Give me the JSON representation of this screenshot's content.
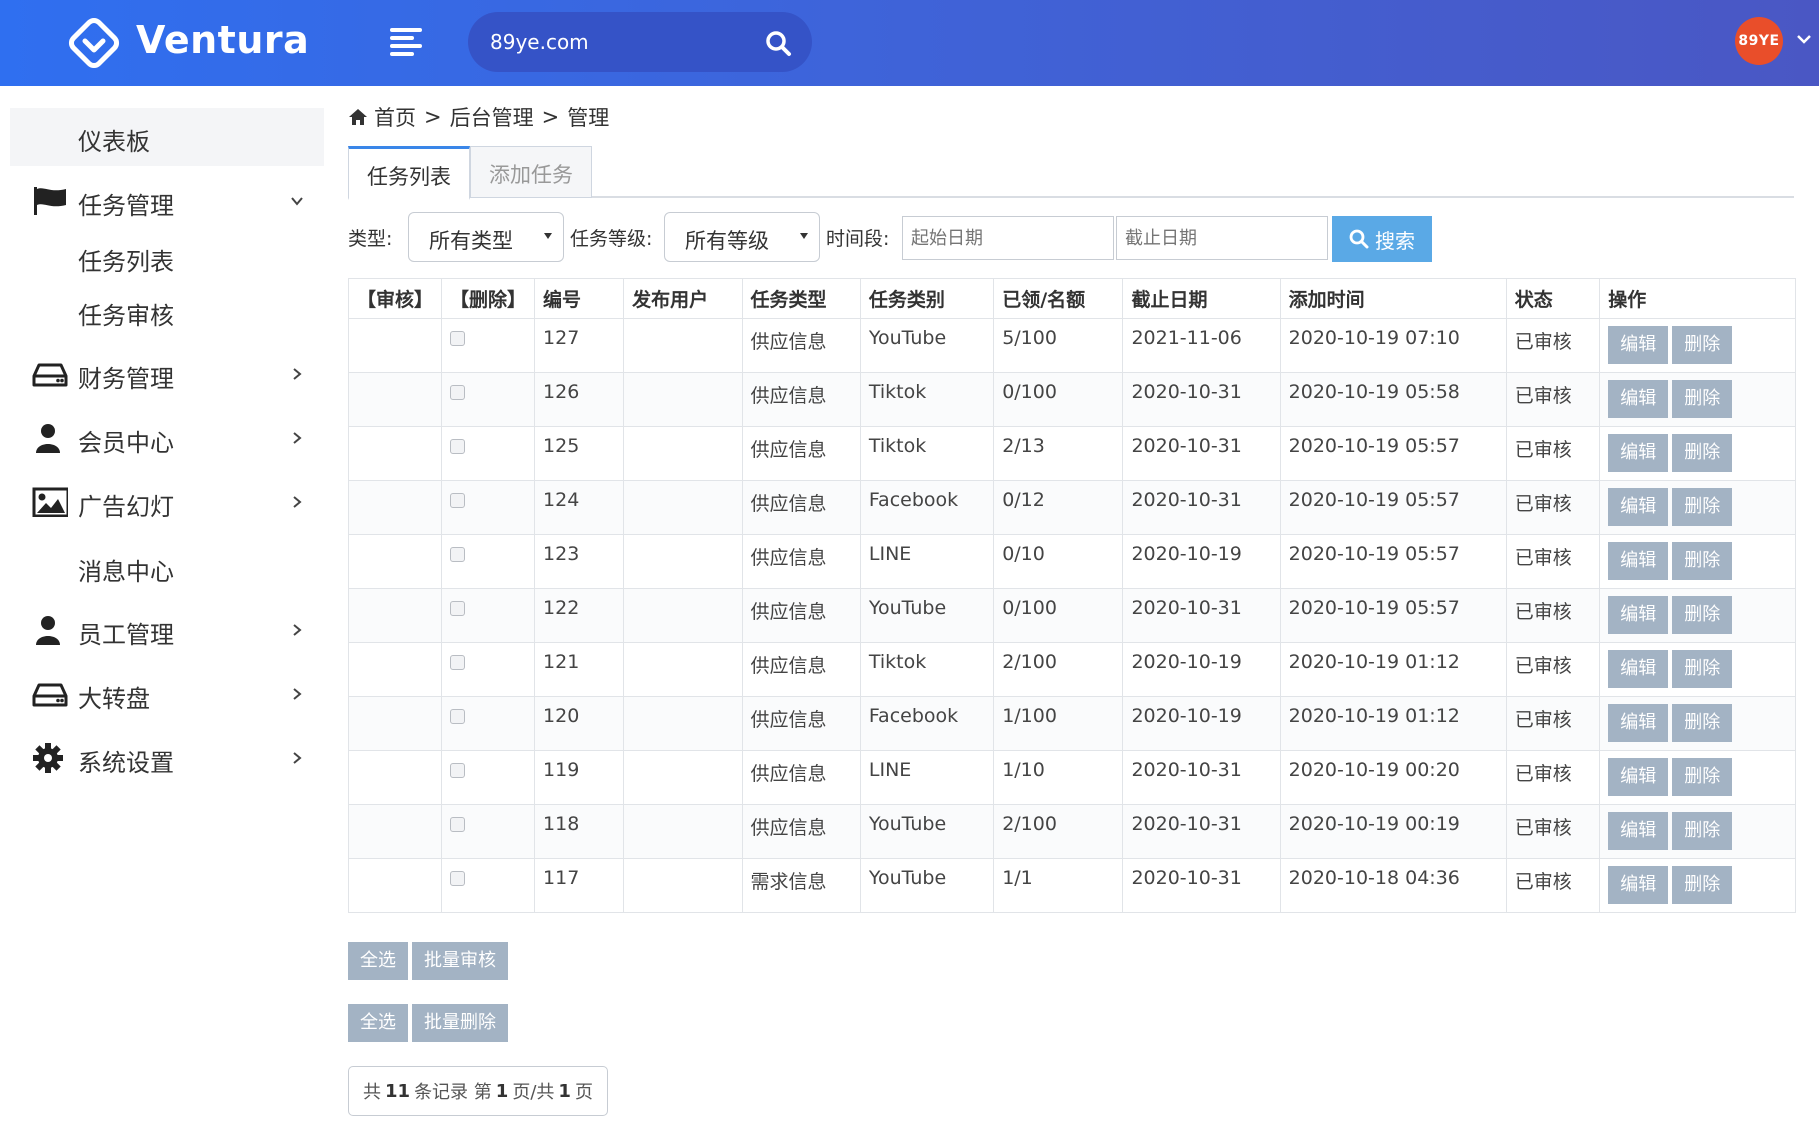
{
  "app": {
    "brand": "Ventura",
    "avatar_text": "89YE"
  },
  "search": {
    "value": "89ye.com"
  },
  "sidebar": {
    "dashboard": "仪表板",
    "task_mgmt": "任务管理",
    "task_list": "任务列表",
    "task_review": "任务审核",
    "finance": "财务管理",
    "member": "会员中心",
    "ads": "广告幻灯",
    "messages": "消息中心",
    "staff": "员工管理",
    "wheel": "大转盘",
    "settings": "系统设置"
  },
  "breadcrumb": {
    "home": "首页",
    "sep1": ">",
    "admin": "后台管理",
    "sep2": ">",
    "manage": "管理"
  },
  "tabs": {
    "list": "任务列表",
    "add": "添加任务"
  },
  "filters": {
    "type_label": "类型:",
    "type_value": "所有类型",
    "level_label": "任务等级:",
    "level_value": "所有等级",
    "period_label": "时间段:",
    "start_placeholder": "起始日期",
    "end_placeholder": "截止日期",
    "search_btn": "搜索"
  },
  "table": {
    "headers": [
      "【审核】",
      "【删除】",
      "编号",
      "发布用户",
      "任务类型",
      "任务类别",
      "已领/名额",
      "截止日期",
      "添加时间",
      "状态",
      "操作"
    ],
    "edit_label": "编辑",
    "delete_label": "删除",
    "rows": [
      {
        "id": "127",
        "user": "",
        "type": "供应信息",
        "cat": "YouTube",
        "quota": "5/100",
        "deadline": "2021-11-06",
        "added": "2020-10-19 07:10",
        "status": "已审核"
      },
      {
        "id": "126",
        "user": "",
        "type": "供应信息",
        "cat": "Tiktok",
        "quota": "0/100",
        "deadline": "2020-10-31",
        "added": "2020-10-19 05:58",
        "status": "已审核"
      },
      {
        "id": "125",
        "user": "",
        "type": "供应信息",
        "cat": "Tiktok",
        "quota": "2/13",
        "deadline": "2020-10-31",
        "added": "2020-10-19 05:57",
        "status": "已审核"
      },
      {
        "id": "124",
        "user": "",
        "type": "供应信息",
        "cat": "Facebook",
        "quota": "0/12",
        "deadline": "2020-10-31",
        "added": "2020-10-19 05:57",
        "status": "已审核"
      },
      {
        "id": "123",
        "user": "",
        "type": "供应信息",
        "cat": "LINE",
        "quota": "0/10",
        "deadline": "2020-10-19",
        "added": "2020-10-19 05:57",
        "status": "已审核"
      },
      {
        "id": "122",
        "user": "",
        "type": "供应信息",
        "cat": "YouTube",
        "quota": "0/100",
        "deadline": "2020-10-31",
        "added": "2020-10-19 05:57",
        "status": "已审核"
      },
      {
        "id": "121",
        "user": "",
        "type": "供应信息",
        "cat": "Tiktok",
        "quota": "2/100",
        "deadline": "2020-10-19",
        "added": "2020-10-19 01:12",
        "status": "已审核"
      },
      {
        "id": "120",
        "user": "",
        "type": "供应信息",
        "cat": "Facebook",
        "quota": "1/100",
        "deadline": "2020-10-19",
        "added": "2020-10-19 01:12",
        "status": "已审核"
      },
      {
        "id": "119",
        "user": "",
        "type": "供应信息",
        "cat": "LINE",
        "quota": "1/10",
        "deadline": "2020-10-31",
        "added": "2020-10-19 00:20",
        "status": "已审核"
      },
      {
        "id": "118",
        "user": "",
        "type": "供应信息",
        "cat": "YouTube",
        "quota": "2/100",
        "deadline": "2020-10-31",
        "added": "2020-10-19 00:19",
        "status": "已审核"
      },
      {
        "id": "117",
        "user": "",
        "type": "需求信息",
        "cat": "YouTube",
        "quota": "1/1",
        "deadline": "2020-10-31",
        "added": "2020-10-18 04:36",
        "status": "已审核"
      }
    ]
  },
  "bulk": {
    "select_all_1": "全选",
    "batch_review": "批量审核",
    "select_all_2": "全选",
    "batch_delete": "批量删除"
  },
  "pager": {
    "prefix": "共",
    "total": "11",
    "mid1": "条记录 第",
    "page": "1",
    "mid2": "页/共",
    "pages": "1",
    "suffix": "页"
  },
  "colors": {
    "topbar_start": "#2f6ff0",
    "topbar_end": "#4a57c4",
    "avatar": "#e94e2a",
    "button_gray": "#a3b3c4",
    "search_btn": "#5aa9e6",
    "tab_accent": "#3a86e8"
  },
  "icons": [
    "logo-icon",
    "hamburger-icon",
    "search-icon",
    "chevron-down-icon",
    "flag-icon",
    "hdd-icon",
    "user-icon",
    "image-icon",
    "gear-icon",
    "home-icon",
    "chevron-right-icon"
  ]
}
